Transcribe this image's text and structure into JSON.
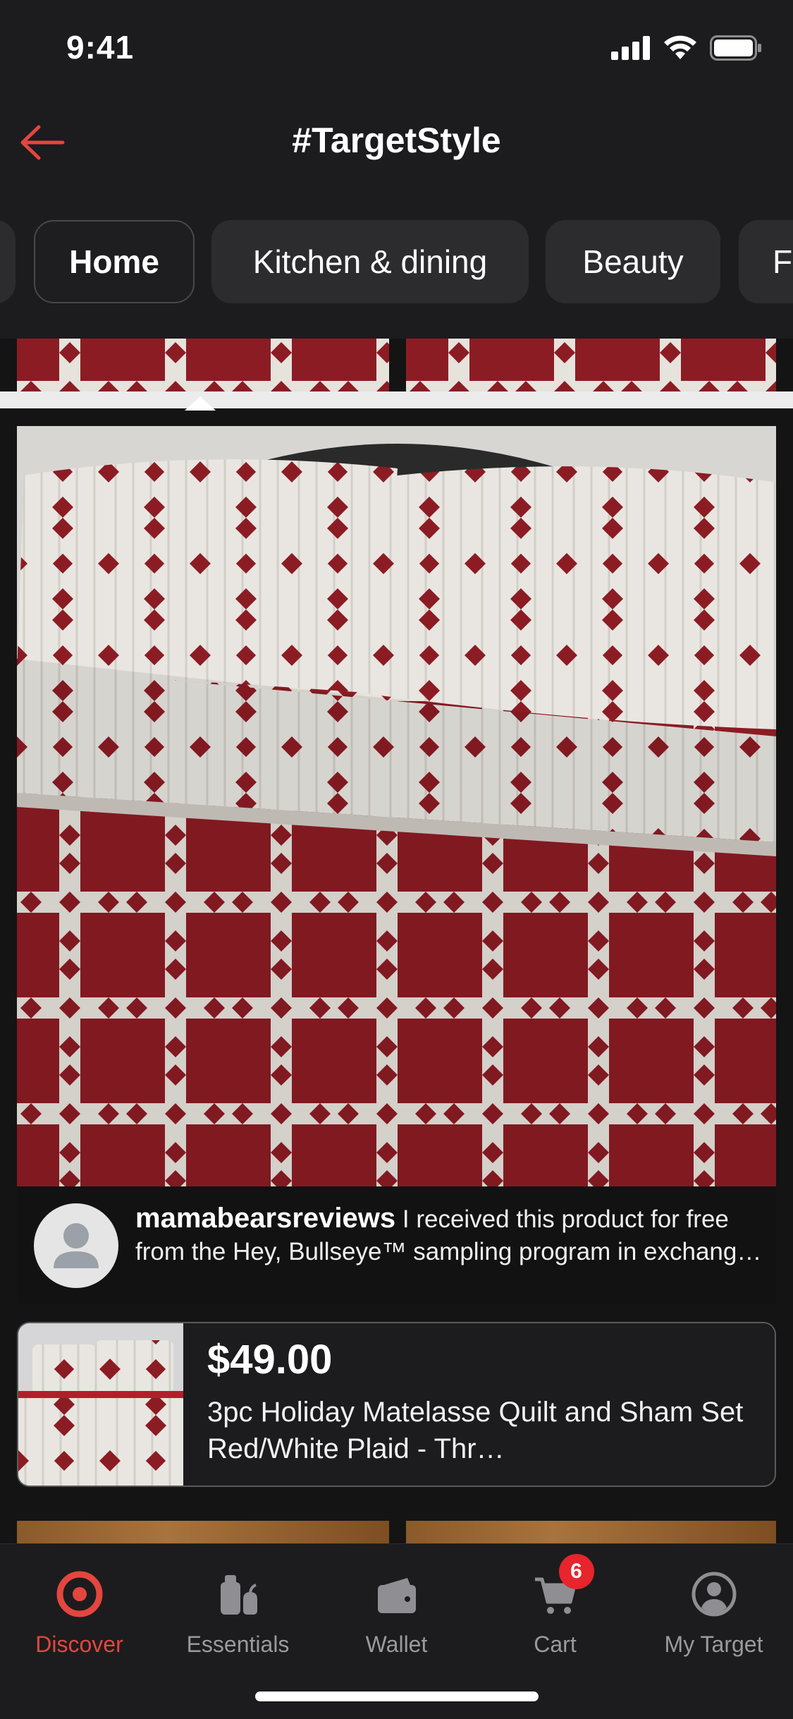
{
  "status_bar": {
    "time": "9:41"
  },
  "nav": {
    "title": "#TargetStyle"
  },
  "chips": [
    {
      "label": ""
    },
    {
      "label": "Home",
      "active": true
    },
    {
      "label": "Kitchen & dining"
    },
    {
      "label": "Beauty"
    },
    {
      "label": "Fu"
    }
  ],
  "review": {
    "username": "mamabearsreviews",
    "text": "I received this product for free from the Hey, Bullseye™ sampling program in exchange for my honest review."
  },
  "product": {
    "price": "$49.00",
    "name": "3pc Holiday Matelasse Quilt and Sham Set Red/White Plaid - Thr…"
  },
  "tabbar": {
    "items": [
      {
        "label": "Discover",
        "icon": "target-bullseye-icon",
        "active": true
      },
      {
        "label": "Essentials",
        "icon": "essentials-icon"
      },
      {
        "label": "Wallet",
        "icon": "wallet-icon"
      },
      {
        "label": "Cart",
        "icon": "cart-icon",
        "badge": "6"
      },
      {
        "label": "My Target",
        "icon": "account-icon"
      }
    ]
  },
  "colors": {
    "accent": "#e3463f",
    "background": "#1c1c1e",
    "badge": "#e8242c",
    "quilt_red": "#8c1c24"
  }
}
